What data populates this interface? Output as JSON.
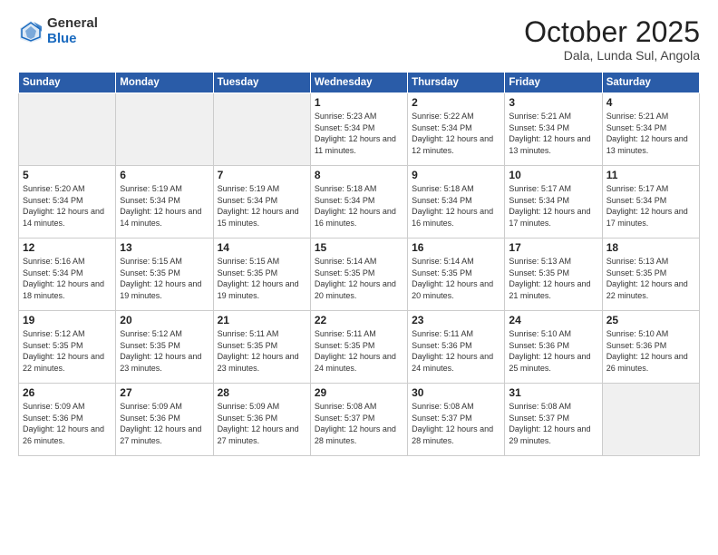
{
  "header": {
    "logo_general": "General",
    "logo_blue": "Blue",
    "month_title": "October 2025",
    "location": "Dala, Lunda Sul, Angola"
  },
  "weekdays": [
    "Sunday",
    "Monday",
    "Tuesday",
    "Wednesday",
    "Thursday",
    "Friday",
    "Saturday"
  ],
  "weeks": [
    [
      {
        "day": "",
        "empty": true
      },
      {
        "day": "",
        "empty": true
      },
      {
        "day": "",
        "empty": true
      },
      {
        "day": "1",
        "sunrise": "5:23 AM",
        "sunset": "5:34 PM",
        "daylight": "12 hours and 11 minutes."
      },
      {
        "day": "2",
        "sunrise": "5:22 AM",
        "sunset": "5:34 PM",
        "daylight": "12 hours and 12 minutes."
      },
      {
        "day": "3",
        "sunrise": "5:21 AM",
        "sunset": "5:34 PM",
        "daylight": "12 hours and 13 minutes."
      },
      {
        "day": "4",
        "sunrise": "5:21 AM",
        "sunset": "5:34 PM",
        "daylight": "12 hours and 13 minutes."
      }
    ],
    [
      {
        "day": "5",
        "sunrise": "5:20 AM",
        "sunset": "5:34 PM",
        "daylight": "12 hours and 14 minutes."
      },
      {
        "day": "6",
        "sunrise": "5:19 AM",
        "sunset": "5:34 PM",
        "daylight": "12 hours and 14 minutes."
      },
      {
        "day": "7",
        "sunrise": "5:19 AM",
        "sunset": "5:34 PM",
        "daylight": "12 hours and 15 minutes."
      },
      {
        "day": "8",
        "sunrise": "5:18 AM",
        "sunset": "5:34 PM",
        "daylight": "12 hours and 16 minutes."
      },
      {
        "day": "9",
        "sunrise": "5:18 AM",
        "sunset": "5:34 PM",
        "daylight": "12 hours and 16 minutes."
      },
      {
        "day": "10",
        "sunrise": "5:17 AM",
        "sunset": "5:34 PM",
        "daylight": "12 hours and 17 minutes."
      },
      {
        "day": "11",
        "sunrise": "5:17 AM",
        "sunset": "5:34 PM",
        "daylight": "12 hours and 17 minutes."
      }
    ],
    [
      {
        "day": "12",
        "sunrise": "5:16 AM",
        "sunset": "5:34 PM",
        "daylight": "12 hours and 18 minutes."
      },
      {
        "day": "13",
        "sunrise": "5:15 AM",
        "sunset": "5:35 PM",
        "daylight": "12 hours and 19 minutes."
      },
      {
        "day": "14",
        "sunrise": "5:15 AM",
        "sunset": "5:35 PM",
        "daylight": "12 hours and 19 minutes."
      },
      {
        "day": "15",
        "sunrise": "5:14 AM",
        "sunset": "5:35 PM",
        "daylight": "12 hours and 20 minutes."
      },
      {
        "day": "16",
        "sunrise": "5:14 AM",
        "sunset": "5:35 PM",
        "daylight": "12 hours and 20 minutes."
      },
      {
        "day": "17",
        "sunrise": "5:13 AM",
        "sunset": "5:35 PM",
        "daylight": "12 hours and 21 minutes."
      },
      {
        "day": "18",
        "sunrise": "5:13 AM",
        "sunset": "5:35 PM",
        "daylight": "12 hours and 22 minutes."
      }
    ],
    [
      {
        "day": "19",
        "sunrise": "5:12 AM",
        "sunset": "5:35 PM",
        "daylight": "12 hours and 22 minutes."
      },
      {
        "day": "20",
        "sunrise": "5:12 AM",
        "sunset": "5:35 PM",
        "daylight": "12 hours and 23 minutes."
      },
      {
        "day": "21",
        "sunrise": "5:11 AM",
        "sunset": "5:35 PM",
        "daylight": "12 hours and 23 minutes."
      },
      {
        "day": "22",
        "sunrise": "5:11 AM",
        "sunset": "5:35 PM",
        "daylight": "12 hours and 24 minutes."
      },
      {
        "day": "23",
        "sunrise": "5:11 AM",
        "sunset": "5:36 PM",
        "daylight": "12 hours and 24 minutes."
      },
      {
        "day": "24",
        "sunrise": "5:10 AM",
        "sunset": "5:36 PM",
        "daylight": "12 hours and 25 minutes."
      },
      {
        "day": "25",
        "sunrise": "5:10 AM",
        "sunset": "5:36 PM",
        "daylight": "12 hours and 26 minutes."
      }
    ],
    [
      {
        "day": "26",
        "sunrise": "5:09 AM",
        "sunset": "5:36 PM",
        "daylight": "12 hours and 26 minutes."
      },
      {
        "day": "27",
        "sunrise": "5:09 AM",
        "sunset": "5:36 PM",
        "daylight": "12 hours and 27 minutes."
      },
      {
        "day": "28",
        "sunrise": "5:09 AM",
        "sunset": "5:36 PM",
        "daylight": "12 hours and 27 minutes."
      },
      {
        "day": "29",
        "sunrise": "5:08 AM",
        "sunset": "5:37 PM",
        "daylight": "12 hours and 28 minutes."
      },
      {
        "day": "30",
        "sunrise": "5:08 AM",
        "sunset": "5:37 PM",
        "daylight": "12 hours and 28 minutes."
      },
      {
        "day": "31",
        "sunrise": "5:08 AM",
        "sunset": "5:37 PM",
        "daylight": "12 hours and 29 minutes."
      },
      {
        "day": "",
        "empty": true
      }
    ]
  ]
}
